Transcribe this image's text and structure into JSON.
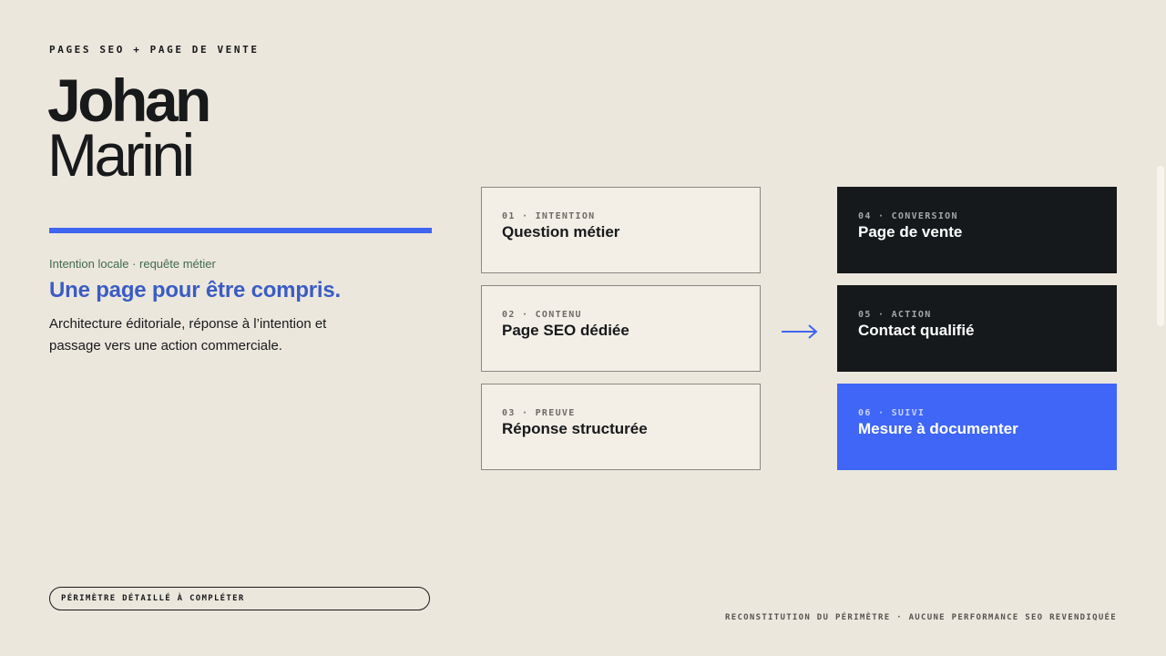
{
  "header": {
    "eyebrow": "PAGES SEO + PAGE DE VENTE",
    "first_name": "Johan",
    "last_name": "Marini"
  },
  "intro": {
    "context": "Intention locale · requête métier",
    "headline": "Une page pour être compris.",
    "description": "Architecture éditoriale, réponse à l’intention et passage vers une action commerciale."
  },
  "scope_pill": "PÉRIMÈTRE DÉTAILLÉ À COMPLÉTER",
  "steps": [
    {
      "tag": "01 · INTENTION",
      "label": "Question métier"
    },
    {
      "tag": "02 · CONTENU",
      "label": "Page SEO dédiée"
    },
    {
      "tag": "03 · PREUVE",
      "label": "Réponse structurée"
    },
    {
      "tag": "04 · CONVERSION",
      "label": "Page de vente"
    },
    {
      "tag": "05 · ACTION",
      "label": "Contact qualifié"
    },
    {
      "tag": "06 · SUIVI",
      "label": "Mesure à documenter"
    }
  ],
  "flow_icon": "arrow-right-icon",
  "footer_note": "RECONSTITUTION DU PÉRIMÈTRE · AUCUNE PERFORMANCE SEO REVENDIQUÉE",
  "colors": {
    "background": "#ece7dd",
    "accent": "#3f66f6",
    "dark": "#15191b",
    "headline": "#3a5cc4",
    "context": "#3f6a4d"
  }
}
